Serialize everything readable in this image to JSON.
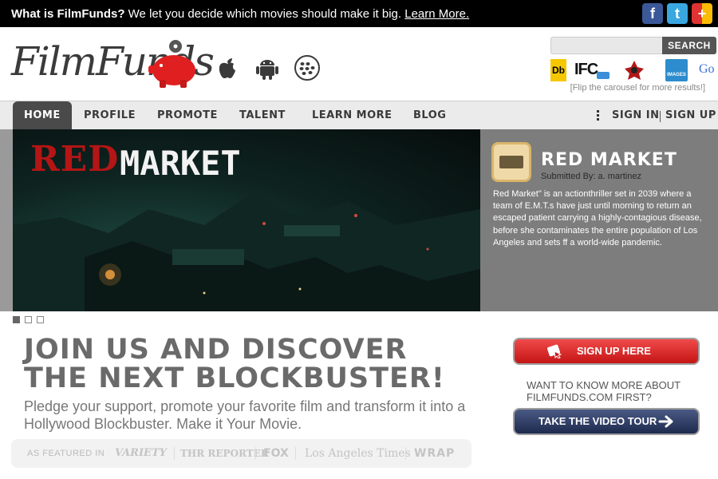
{
  "banner": {
    "question": "What is FilmFunds?",
    "message": " We let you decide which movies should make it big. ",
    "learn_more": "Learn More."
  },
  "social": {
    "facebook": "f",
    "twitter": "t",
    "googleplus": "+"
  },
  "header": {
    "logo_text": "FilmFunds",
    "search": {
      "placeholder": "",
      "button": "SEARCH"
    },
    "carousel": [
      "IMDb",
      "IFC",
      "Red",
      "IMAGES",
      "Go"
    ],
    "carousel_labels": {
      "db": "Db",
      "ifc": "IFC",
      "images": "IMAGES",
      "google": "Go"
    },
    "flip_hint": "[Flip the carousel for more results!]"
  },
  "nav": {
    "items": [
      "HOME",
      "PROFILE",
      "PROMOTE",
      "TALENT",
      "LEARN MORE",
      "BLOG"
    ],
    "sign_in": "SIGN IN",
    "sign_up": "SIGN UP"
  },
  "hero": {
    "image_title_red": "RED",
    "image_title_white": "MARKET",
    "film_title": "RED MARKET",
    "submitted_by": "Submitted By: a. martinez",
    "description": "Red Market\" is an actionthriller set in 2039 where a team of E.M.T.s have just until morning to return an escaped patient carrying a highly-contagious disease, before she contaminates the entire population of Los Angeles and sets ff a world-wide pandemic.",
    "pager": {
      "total": 3,
      "active": 1
    }
  },
  "join": {
    "line1": "JOIN US AND DISCOVER",
    "line2": "THE NEXT BLOCKBUSTER!",
    "pledge": "Pledge your support, promote your favorite film and transform it into a Hollywood Blockbuster. Make it Your Movie."
  },
  "featured": {
    "label": "AS FEATURED IN",
    "outlets": [
      "Variety",
      "The Hollywood Reporter",
      "FOX",
      "Los Angeles Times",
      "WRAP"
    ],
    "outlet_labels": {
      "variety": "VARIETY",
      "thr": "THR REPORTER",
      "fox": "FOX",
      "lat": "Los Angeles Times",
      "wrap": "WRAP"
    }
  },
  "cta": {
    "signup": "SIGN UP HERE",
    "want_line1": "WANT TO KNOW MORE ABOUT",
    "want_line2": "FILMFUNDS.COM FIRST?",
    "tour": "TAKE THE VIDEO TOUR"
  },
  "colors": {
    "accent_red": "#d42020",
    "nav_active": "#4a4a4a",
    "tour_blue": "#2e3a62"
  }
}
